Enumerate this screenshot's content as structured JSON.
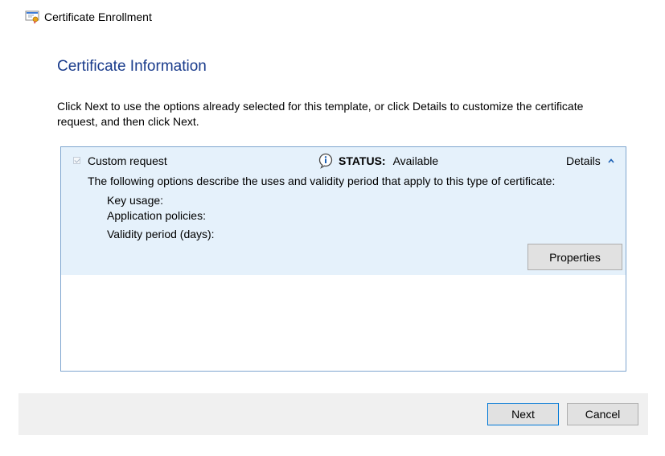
{
  "window": {
    "title": "Certificate Enrollment",
    "icon": "certificate-icon"
  },
  "page": {
    "title": "Certificate Information",
    "instructions": "Click Next to use the options already selected for this template, or click Details to customize the certificate request, and then click Next."
  },
  "certificate_list": {
    "items": [
      {
        "name": "Custom request",
        "checked": true,
        "checkbox_disabled": true,
        "status_icon": "info-icon",
        "status_label": "STATUS:",
        "status_value": "Available",
        "details_label": "Details",
        "details_expanded": true,
        "description": "The following options describe the uses and validity period that apply to this type of certificate:",
        "fields": [
          {
            "label": "Key usage:"
          },
          {
            "label": "Application policies:"
          },
          {
            "label": "Validity period (days):"
          }
        ],
        "properties_label": "Properties"
      }
    ]
  },
  "footer": {
    "next_label": "Next",
    "cancel_label": "Cancel"
  },
  "colors": {
    "accent": "#0078d7",
    "selected_item_bg": "#e5f1fb",
    "title_text": "#1a3c8c",
    "footer_bg": "#f0f0f0"
  }
}
